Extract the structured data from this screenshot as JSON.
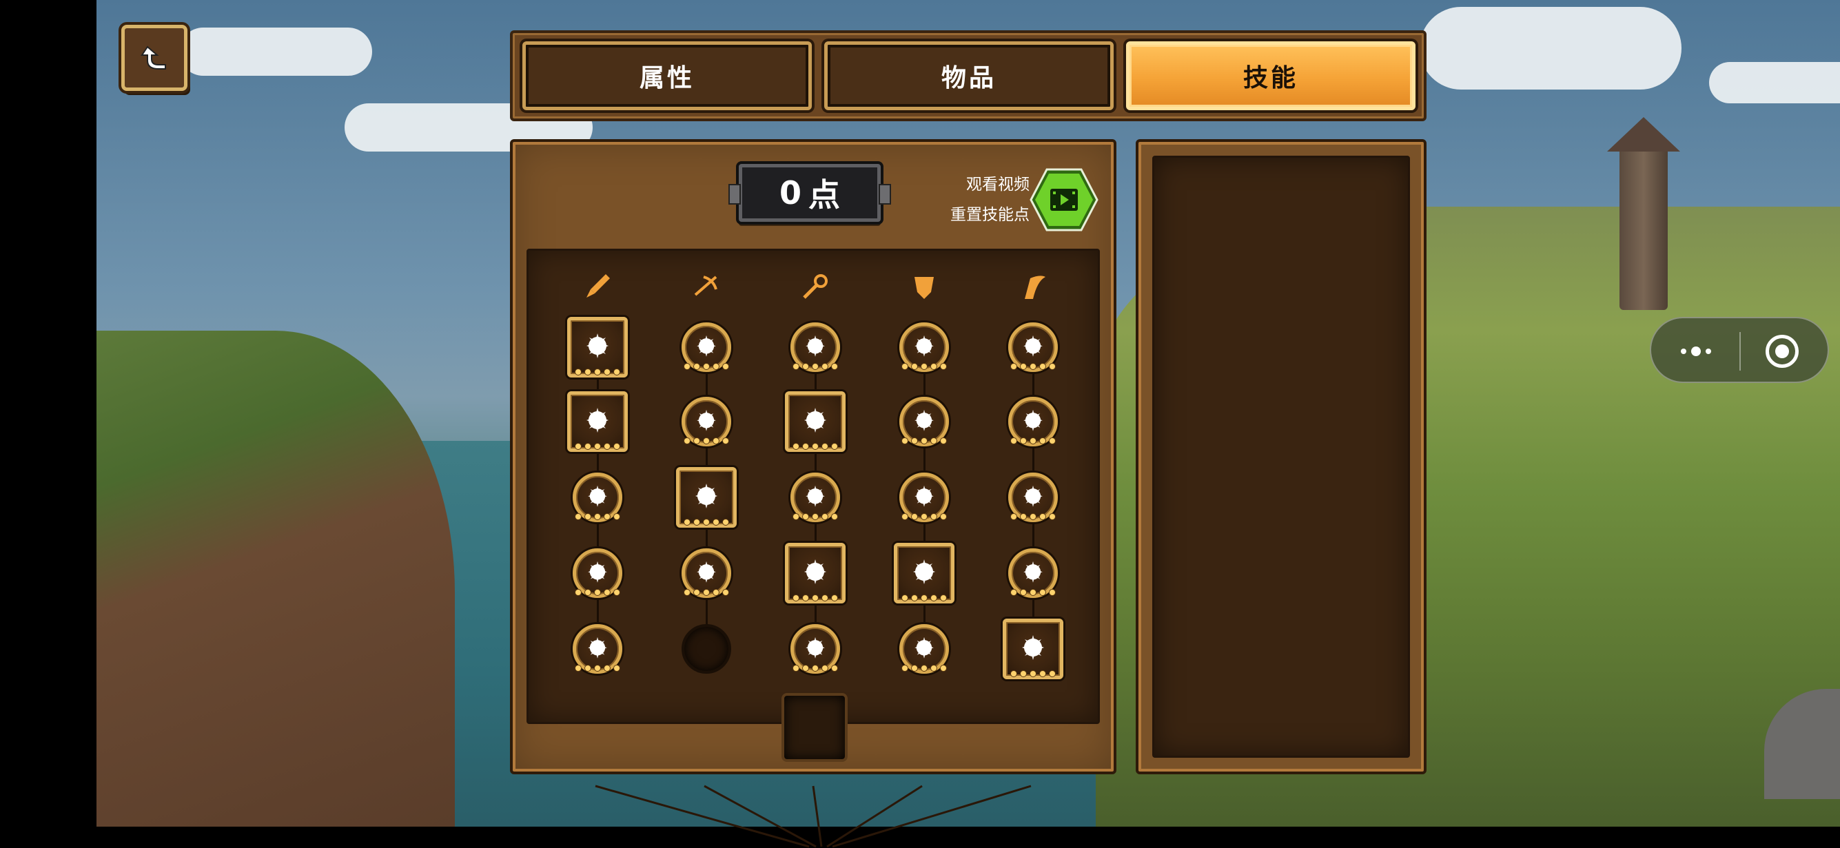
{
  "tabs": [
    {
      "label": "属性",
      "active": false
    },
    {
      "label": "物品",
      "active": false
    },
    {
      "label": "技能",
      "active": true
    }
  ],
  "skill_points": {
    "value": "0",
    "unit": "点"
  },
  "reset": {
    "line1": "观看视频",
    "line2": "重置技能点"
  },
  "column_icons": [
    "sword-icon",
    "crossbow-icon",
    "magic-comet-icon",
    "shield-icon",
    "wing-icon"
  ],
  "skill_grid": [
    [
      "explosion-icon",
      "bow-target-icon",
      "sunburst-icon",
      "hearts-icon",
      "swirl-icon"
    ],
    [
      "spiral-icon",
      "arrow-drop-icon",
      "fireball-icon",
      "shield-sword-icon",
      "crossbow-bolt-icon"
    ],
    [
      "coins-icon",
      "skull-crossbones-icon",
      "crosshair-icon",
      "shield-heart-icon",
      "crossed-swords-icon"
    ],
    [
      "impact-icon",
      "bow-shot-icon",
      "lightning-icon",
      "guard-icon",
      "winged-helm-icon"
    ],
    [
      "fist-icon",
      "locked-slot",
      "recycle-icon",
      "triple-orb-icon",
      "plus-cross-icon"
    ]
  ],
  "colors": {
    "accent_tab": "#f5a337",
    "frame": "#c89c55",
    "panel": "#7a5228",
    "dot": "#ffd36e"
  }
}
